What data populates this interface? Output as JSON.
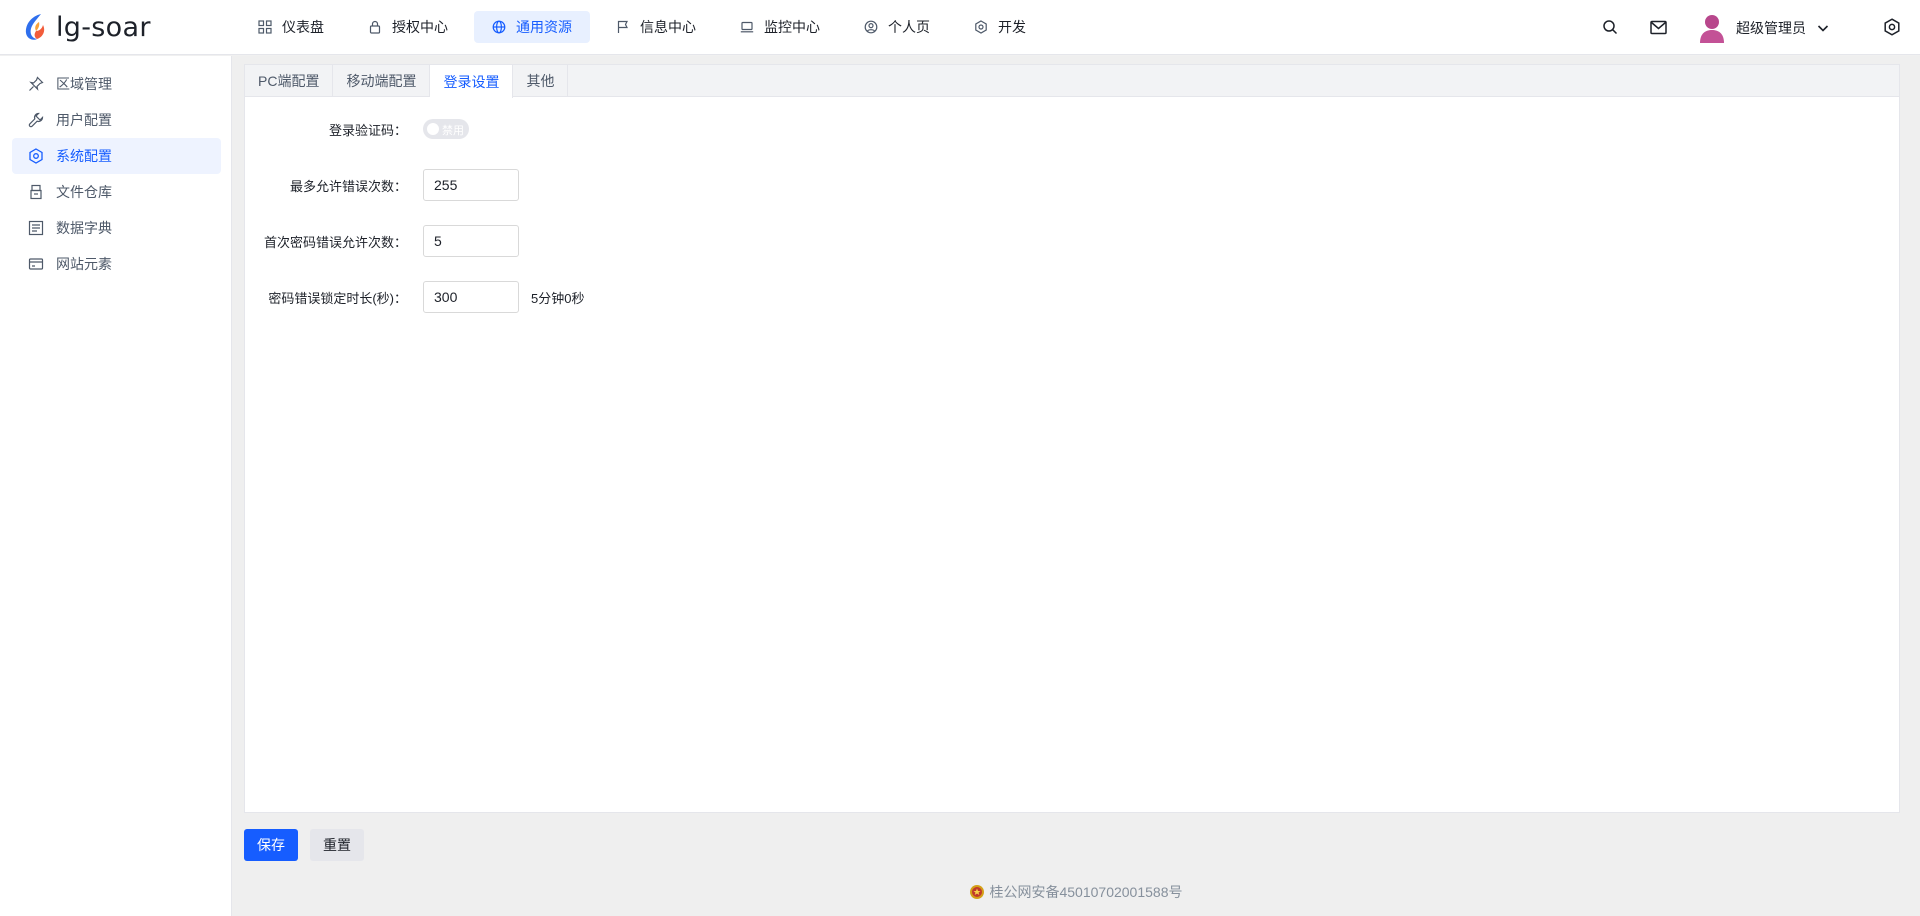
{
  "app": {
    "title": "lg-soar"
  },
  "topnav": [
    {
      "label": "仪表盘",
      "icon": "grid-icon"
    },
    {
      "label": "授权中心",
      "icon": "lock-icon"
    },
    {
      "label": "通用资源",
      "icon": "globe-icon",
      "active": true
    },
    {
      "label": "信息中心",
      "icon": "flag-icon"
    },
    {
      "label": "监控中心",
      "icon": "laptop-icon"
    },
    {
      "label": "个人页",
      "icon": "user-circle-icon"
    },
    {
      "label": "开发",
      "icon": "gear-icon"
    }
  ],
  "header": {
    "user_name": "超级管理员"
  },
  "sidebar": {
    "items": [
      {
        "label": "区域管理",
        "icon": "pin-icon"
      },
      {
        "label": "用户配置",
        "icon": "wrench-icon"
      },
      {
        "label": "系统配置",
        "icon": "hexagon-gear-icon",
        "active": true
      },
      {
        "label": "文件仓库",
        "icon": "storage-icon"
      },
      {
        "label": "数据字典",
        "icon": "list-icon"
      },
      {
        "label": "网站元素",
        "icon": "card-icon"
      }
    ]
  },
  "tabs": [
    {
      "label": "PC端配置"
    },
    {
      "label": "移动端配置"
    },
    {
      "label": "登录设置",
      "active": true
    },
    {
      "label": "其他"
    }
  ],
  "form": {
    "captcha_label": "登录验证码：",
    "captcha_switch_text": "禁用",
    "max_errors_label": "最多允许错误次数：",
    "max_errors_value": "255",
    "first_errors_label": "首次密码错误允许次数：",
    "first_errors_value": "5",
    "lock_duration_label": "密码错误锁定时长(秒)：",
    "lock_duration_value": "300",
    "lock_duration_hint": "5分钟0秒"
  },
  "actions": {
    "save_label": "保存",
    "reset_label": "重置"
  },
  "footer": {
    "icp_text": "桂公网安备45010702001588号"
  },
  "colors": {
    "accent": "#165dff",
    "active_bg": "#e8f0ff"
  }
}
